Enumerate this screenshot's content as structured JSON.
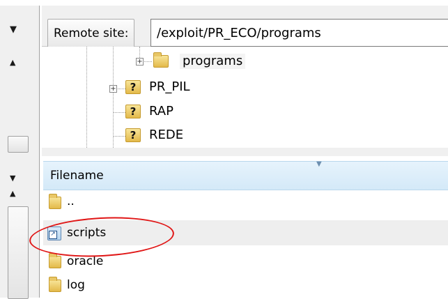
{
  "remote": {
    "label": "Remote site:",
    "path": "/exploit/PR_ECO/programs"
  },
  "tree": {
    "items": [
      {
        "label": "programs",
        "selected": true
      },
      {
        "label": "PR_PIL"
      },
      {
        "label": "RAP"
      },
      {
        "label": "REDE"
      }
    ]
  },
  "file_list": {
    "header": "Filename",
    "rows": [
      {
        "label": ".."
      },
      {
        "label": "scripts",
        "icon": "shortcut-folder-icon"
      },
      {
        "label": "oracle"
      },
      {
        "label": "log"
      }
    ]
  },
  "colors": {
    "annotation": "#e01515",
    "header_bg": "#d4e9f8"
  }
}
